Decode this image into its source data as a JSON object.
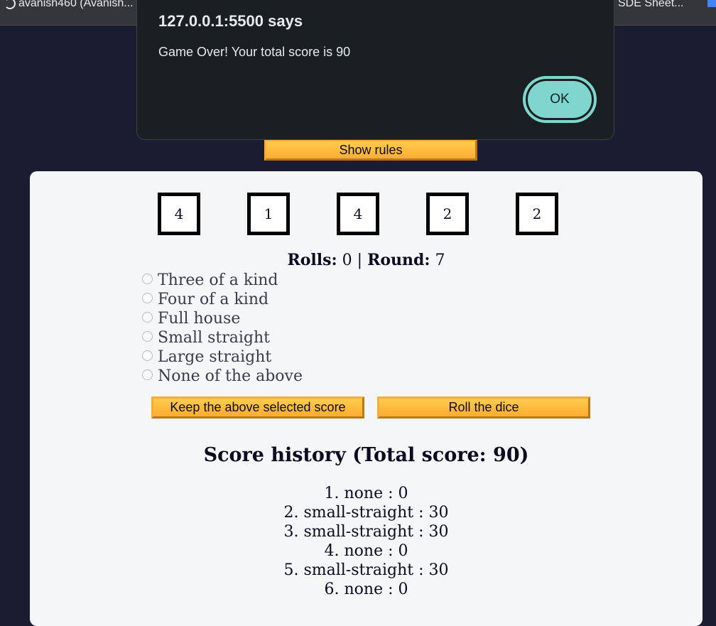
{
  "browser": {
    "bookmark_left": "avanish460 (Avanish...",
    "bookmark_right": "SDE Sheet..."
  },
  "alert": {
    "title": "127.0.0.1:5500 says",
    "message": "Game Over! Your total score is 90",
    "ok_label": "OK"
  },
  "rules_button": "Show rules",
  "dice": [
    "4",
    "1",
    "4",
    "2",
    "2"
  ],
  "status": {
    "rolls_label": "Rolls:",
    "rolls_value": "0",
    "separator": "|",
    "round_label": "Round:",
    "round_value": "7"
  },
  "score_options": [
    {
      "label": "Three of a kind",
      "selected": false
    },
    {
      "label": "Four of a kind",
      "selected": false
    },
    {
      "label": "Full house",
      "selected": false
    },
    {
      "label": "Small straight",
      "selected": false
    },
    {
      "label": "Large straight",
      "selected": false
    },
    {
      "label": "None of the above",
      "selected": false
    }
  ],
  "buttons": {
    "keep_score": "Keep the above selected score",
    "roll_dice": "Roll the dice"
  },
  "history": {
    "title": "Score history (Total score: 90)",
    "items": [
      "1. none : 0",
      "2. small-straight : 30",
      "3. small-straight : 30",
      "4. none : 0",
      "5. small-straight : 30",
      "6. none : 0"
    ]
  },
  "colors": {
    "page_bg": "#1b1b32",
    "panel_bg": "#f5f6f7",
    "button_bg": "#feac32",
    "dialog_bg": "#1a1f21",
    "ok_accent": "#7ed6ce"
  }
}
